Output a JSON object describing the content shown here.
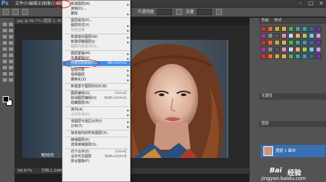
{
  "app": {
    "logo": "Ps"
  },
  "menubar": {
    "items": [
      "文件(F)",
      "编辑(E)",
      "图像(I)",
      "图层(L)"
    ],
    "right_icons": [
      "minimize-icon",
      "restore-icon",
      "close-icon"
    ]
  },
  "options": {
    "label1": "不透明度",
    "label2": "流量"
  },
  "document": {
    "tab": "jpg @ 66.7% (图层 1, RGB/8)",
    "zoom": "66.67%",
    "info": "文档:1.24M/3.30M"
  },
  "photo_caption": "昵时间",
  "dropdown": {
    "items": [
      {
        "label": "新建图层(N)",
        "shortcut": "",
        "submenu": true
      },
      {
        "label": "复制(D)...",
        "shortcut": ""
      },
      {
        "label": "删除",
        "shortcut": "",
        "submenu": true
      },
      {
        "sep": true
      },
      {
        "label": "图层属性(P)...",
        "shortcut": ""
      },
      {
        "label": "图层样式(Y)",
        "shortcut": "",
        "submenu": true
      },
      {
        "label": "智能滤镜",
        "shortcut": "",
        "submenu": true,
        "disabled": true
      },
      {
        "sep": true
      },
      {
        "label": "新建填充图层(W)",
        "shortcut": "",
        "submenu": true
      },
      {
        "label": "新建调整图层(J)",
        "shortcut": "",
        "submenu": true
      },
      {
        "label": "图层内容选项(O)...",
        "shortcut": "",
        "disabled": true
      },
      {
        "sep": true
      },
      {
        "label": "图层蒙版(M)",
        "shortcut": "",
        "submenu": true
      },
      {
        "label": "矢量蒙版(V)",
        "shortcut": "",
        "submenu": true
      },
      {
        "label": "创建剪贴蒙版(C)",
        "shortcut": "Alt+Ctrl+G",
        "selected": true
      },
      {
        "sep": true
      },
      {
        "label": "智能对象",
        "shortcut": "",
        "submenu": true
      },
      {
        "label": "视频图层",
        "shortcut": "",
        "submenu": true
      },
      {
        "label": "栅格化(Z)",
        "shortcut": "",
        "submenu": true
      },
      {
        "sep": true
      },
      {
        "label": "新建基于图层的切片(B)",
        "shortcut": ""
      },
      {
        "sep": true
      },
      {
        "label": "图层编组(G)",
        "shortcut": "Ctrl+G"
      },
      {
        "label": "取消图层编组(U)",
        "shortcut": "Shift+Ctrl+G"
      },
      {
        "label": "隐藏图层(R)",
        "shortcut": ""
      },
      {
        "sep": true
      },
      {
        "label": "排列(A)",
        "shortcut": "",
        "submenu": true
      },
      {
        "label": "合并形状(H)",
        "shortcut": "",
        "submenu": true,
        "disabled": true
      },
      {
        "sep": true
      },
      {
        "label": "将图层与选区对齐(I)",
        "shortcut": "",
        "submenu": true
      },
      {
        "label": "分布(T)",
        "shortcut": "",
        "submenu": true
      },
      {
        "sep": true
      },
      {
        "label": "锁定组内的所有图层(X)...",
        "shortcut": ""
      },
      {
        "sep": true
      },
      {
        "label": "链接图层(K)",
        "shortcut": ""
      },
      {
        "label": "选择链接图层(S)",
        "shortcut": ""
      },
      {
        "sep": true
      },
      {
        "label": "向下合并(E)",
        "shortcut": "Ctrl+E"
      },
      {
        "label": "合并可见图层",
        "shortcut": "Shift+Ctrl+E"
      },
      {
        "label": "拼合图像(F)",
        "shortcut": ""
      }
    ]
  },
  "panels": {
    "tab1": "色板",
    "tab2": "样式",
    "tab3": "无属性",
    "layers_tab": "图层",
    "layer_name": "图层 1 副本"
  },
  "watermark": {
    "text1": "Bai",
    "text2": "经验",
    "url": "jingyan.baidu.com"
  },
  "colors": {
    "accent": "#3a8ee6",
    "annotation": "#e01010",
    "ps_blue": "#5aa9ff"
  }
}
